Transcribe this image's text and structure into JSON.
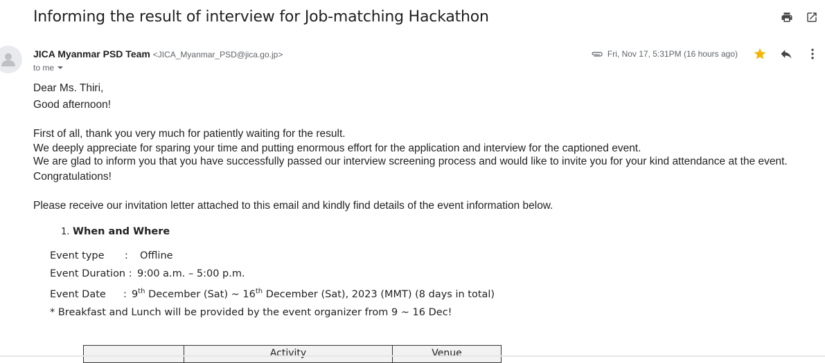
{
  "email": {
    "subject": "Informing the result of interview for Job-matching Hackathon",
    "sender_name": "JICA Myanmar PSD Team",
    "sender_email": "<JICA_Myanmar_PSD@jica.go.jp>",
    "to": "to me",
    "date": "Fri, Nov 17, 5:31PM (16 hours ago)",
    "star_color": "#f4b400"
  },
  "body": {
    "greeting1": "Dear Ms. Thiri,",
    "greeting2": "Good afternoon!",
    "p1": "First of all, thank you very much for patiently waiting for the result.",
    "p2": "We deeply appreciate for sparing your time and putting enormous effort for the application and interview for the captioned event.",
    "p3": "We are glad to inform you that you have successfully passed our interview screening process and would like to invite you for your kind attendance at the event.",
    "p4": "Congratulations!",
    "p5": "Please receive our invitation letter attached to this email and kindly find details of the event information below.",
    "section_number": "1.",
    "section_title": "When and Where",
    "event_type_label": "Event type",
    "event_type_value": "Offline",
    "duration_label": "Event Duration :",
    "duration_value": "9:00 a.m. – 5:00 p.m.",
    "date_label": "Event Date",
    "date_day1": "9",
    "date_sup1": "th",
    "date_mid": " December (Sat) ~ 16",
    "date_sup2": "th",
    "date_end": " December (Sat), 2023 (MMT) (8 days in total)",
    "note": "* Breakfast and Lunch will be provided by the event organizer from 9 ~ 16 Dec!",
    "colon": ":"
  },
  "table": {
    "headers": [
      "",
      "Activity",
      "Venue"
    ]
  },
  "icons": {
    "print": "print-icon",
    "open_new": "open-in-new-window-icon",
    "attachment": "attachment-icon",
    "star": "star-icon",
    "reply": "reply-icon",
    "more": "more-vert-icon",
    "dropdown": "chevron-down-icon",
    "avatar": "avatar-icon"
  }
}
